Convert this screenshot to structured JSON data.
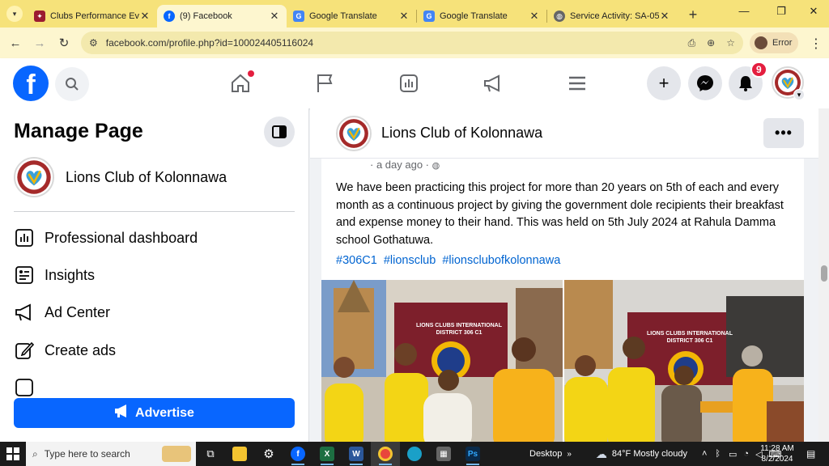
{
  "browser": {
    "tabs": [
      {
        "title": "Clubs Performance Eva",
        "favicon": "lions-favicon",
        "active": false
      },
      {
        "title": "(9) Facebook",
        "favicon": "facebook-favicon",
        "active": true
      },
      {
        "title": "Google Translate",
        "favicon": "translate-favicon",
        "active": false
      },
      {
        "title": "Google Translate",
        "favicon": "translate-favicon",
        "active": false
      },
      {
        "title": "Service Activity: SA-05",
        "favicon": "globe-favicon",
        "active": false
      }
    ],
    "url": "facebook.com/profile.php?id=100024405116024",
    "profile_label": "Error"
  },
  "fb": {
    "notification_count": "9",
    "accent": "#0866ff"
  },
  "sidebar": {
    "title": "Manage Page",
    "page_name": "Lions Club of Kolonnawa",
    "items": [
      {
        "label": "Professional dashboard",
        "icon": "dashboard-icon"
      },
      {
        "label": "Insights",
        "icon": "insights-icon"
      },
      {
        "label": "Ad Center",
        "icon": "megaphone-icon"
      },
      {
        "label": "Create ads",
        "icon": "edit-icon"
      }
    ],
    "advertise_label": "Advertise"
  },
  "post": {
    "author": "Lions Club of Kolonnawa",
    "time": "· a day ago ·",
    "text": "We have been practicing this project for more than 20 years on 5th of each and every month as a continuous project by giving the government dole recipients their breakfast and expense money to their hand. This was held on 5th July 2024 at Rahula Damma school Gothatuwa.",
    "hashtags": [
      "#306C1",
      "#lionsclub",
      "#lionsclubofkolonnawa"
    ],
    "banner_text_1": "LIONS CLUBS INTERNATIONAL",
    "banner_text_2": "DISTRICT 306 C1"
  },
  "taskbar": {
    "search_placeholder": "Type here to search",
    "desktop_label": "Desktop",
    "weather": "84°F  Mostly cloudy",
    "time": "11:28 AM",
    "date": "8/2/2024"
  }
}
